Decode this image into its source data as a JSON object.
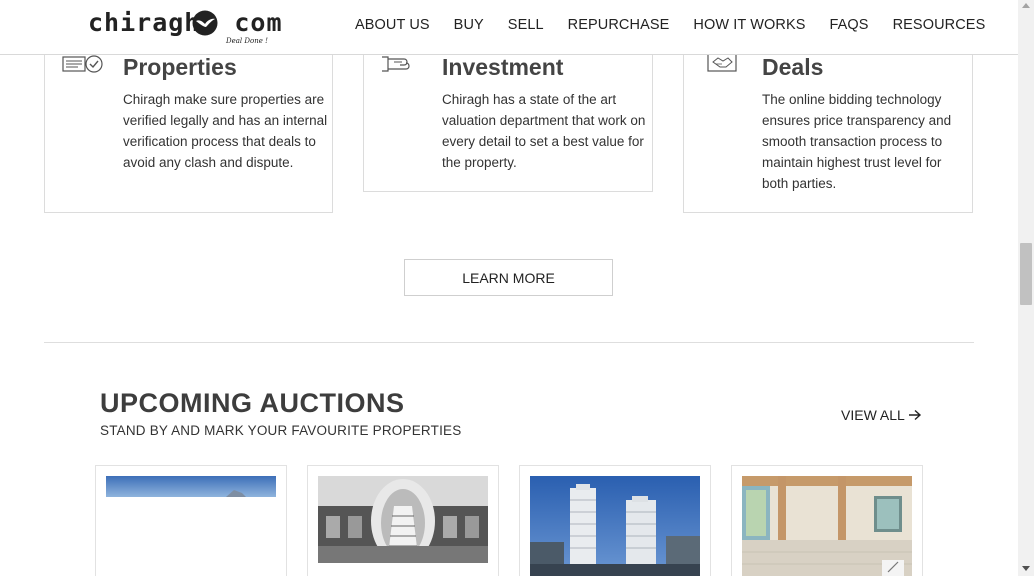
{
  "header": {
    "logo": {
      "left": "chiragh",
      "right": "com",
      "tagline": "Deal Done !"
    },
    "nav": [
      "ABOUT US",
      "BUY",
      "SELL",
      "REPURCHASE",
      "HOW IT WORKS",
      "FAQS",
      "RESOURCES"
    ]
  },
  "features": [
    {
      "title": "Properties",
      "text": "Chiragh make sure properties are verified legally and has an internal verification process that deals to avoid any clash and dispute.",
      "icon": "verified-document-icon"
    },
    {
      "title": "Investment",
      "text": "Chiragh has a state of the art valuation department that work on every detail to set a best value for the property.",
      "icon": "valuation-hand-icon"
    },
    {
      "title": "Deals",
      "text": "The online bidding technology ensures price transparency and smooth transaction process to maintain highest trust level for both parties.",
      "icon": "handshake-deal-icon"
    }
  ],
  "learn_more_label": "LEARN MORE",
  "auctions": {
    "title": "UPCOMING AUCTIONS",
    "subtitle": "STAND BY AND MARK YOUR FAVOURITE PROPERTIES",
    "view_all_label": "VIEW ALL",
    "items": [
      {
        "image": "sky-building-photo"
      },
      {
        "image": "panoramic-interior-photo"
      },
      {
        "image": "twin-towers-photo"
      },
      {
        "image": "terrace-photo"
      }
    ]
  },
  "colors": {
    "text": "#333333",
    "border": "#dcdcdc",
    "scroll_thumb": "#c1c1c1"
  }
}
